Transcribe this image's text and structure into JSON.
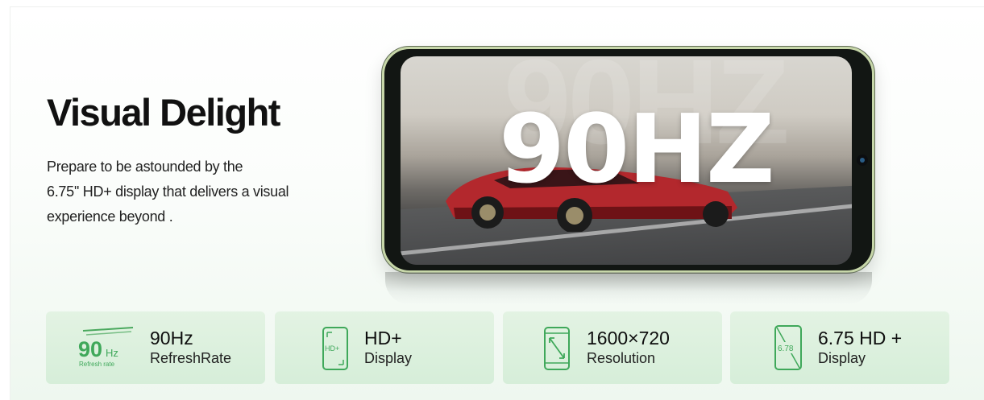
{
  "hero": {
    "title": "Visual Delight",
    "description_lines": [
      "Prepare to be astounded by the",
      "6.75'' HD+ display that delivers a visual",
      "experience beyond  ."
    ]
  },
  "phone_screen": {
    "overlay_text": "90HZ",
    "ghost_text": "90HZ"
  },
  "features": [
    {
      "icon": "refresh-rate-icon",
      "icon_big": "90",
      "icon_unit": "Hz",
      "icon_caption": "Refresh rate",
      "value": "90Hz",
      "label": "RefreshRate"
    },
    {
      "icon": "hd-plus-phone-icon",
      "icon_text": "HD+",
      "value": "HD+",
      "label": "Display"
    },
    {
      "icon": "resolution-phone-icon",
      "value": "1600×720",
      "label": "Resolution"
    },
    {
      "icon": "screen-size-phone-icon",
      "icon_text": "6.78",
      "value": "6.75 HD +",
      "label": "Display"
    }
  ],
  "colors": {
    "accent_green": "#3fa85a",
    "card_bg": "#dcf0dd",
    "phone_frame": "#c7d7a9"
  }
}
